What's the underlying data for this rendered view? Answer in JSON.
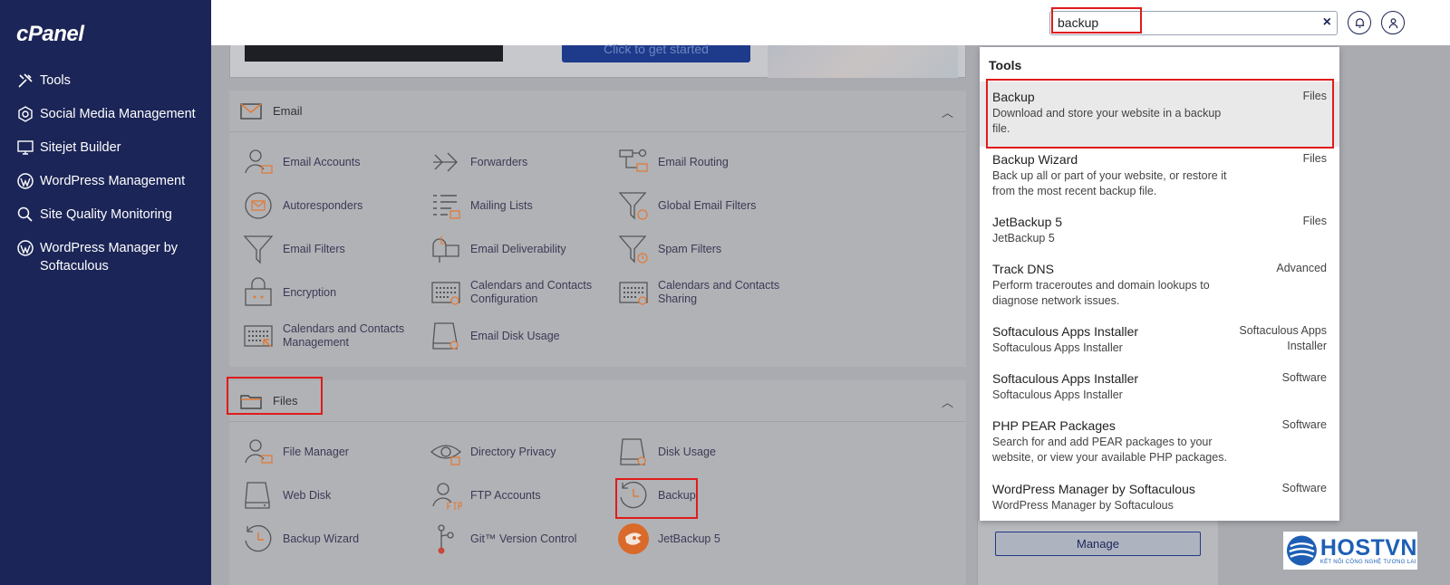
{
  "app": {
    "logo": "cPanel"
  },
  "sidebar": {
    "items": [
      {
        "label": "Tools",
        "icon": "tools-icon"
      },
      {
        "label": "Social Media Management",
        "icon": "social-media-icon"
      },
      {
        "label": "Sitejet Builder",
        "icon": "sitejet-icon"
      },
      {
        "label": "WordPress Management",
        "icon": "wordpress-icon"
      },
      {
        "label": "Site Quality Monitoring",
        "icon": "site-quality-icon"
      },
      {
        "label": "WordPress Manager by Softaculous",
        "icon": "wordpress-icon"
      }
    ]
  },
  "search": {
    "value": "backup",
    "clear": "×"
  },
  "banner": {
    "cta_label": "Click to get started"
  },
  "email_section": {
    "title": "Email",
    "tools": [
      {
        "label": "Email Accounts",
        "icon": "email-accounts-icon"
      },
      {
        "label": "Forwarders",
        "icon": "forwarders-icon"
      },
      {
        "label": "Email Routing",
        "icon": "email-routing-icon"
      },
      {
        "label": "Autoresponders",
        "icon": "autoresponders-icon"
      },
      {
        "label": "Mailing Lists",
        "icon": "mailing-lists-icon"
      },
      {
        "label": "Global Email Filters",
        "icon": "global-filter-icon"
      },
      {
        "label": "Email Filters",
        "icon": "filter-icon"
      },
      {
        "label": "Email Deliverability",
        "icon": "mailbox-icon"
      },
      {
        "label": "Spam Filters",
        "icon": "spam-filter-icon"
      },
      {
        "label": "Encryption",
        "icon": "encryption-icon"
      },
      {
        "label": "Calendars and Contacts Configuration",
        "icon": "calendar-config-icon"
      },
      {
        "label": "Calendars and Contacts Sharing",
        "icon": "calendar-share-icon"
      },
      {
        "label": "Calendars and Contacts Management",
        "icon": "calendar-manage-icon"
      },
      {
        "label": "Email Disk Usage",
        "icon": "disk-usage-icon"
      }
    ]
  },
  "files_section": {
    "title": "Files",
    "tools": [
      {
        "label": "File Manager",
        "icon": "file-manager-icon"
      },
      {
        "label": "Directory Privacy",
        "icon": "eye-icon"
      },
      {
        "label": "Disk Usage",
        "icon": "disk-usage-icon"
      },
      {
        "label": "Web Disk",
        "icon": "web-disk-icon"
      },
      {
        "label": "FTP Accounts",
        "icon": "ftp-icon"
      },
      {
        "label": "Backup",
        "icon": "backup-icon"
      },
      {
        "label": "Backup Wizard",
        "icon": "backup-wizard-icon"
      },
      {
        "label": "Git™ Version Control",
        "icon": "git-icon"
      },
      {
        "label": "JetBackup 5",
        "icon": "jetbackup-icon"
      }
    ]
  },
  "dropdown": {
    "heading": "Tools",
    "results": [
      {
        "title": "Backup",
        "desc": "Download and store your website in a backup file.",
        "category": "Files"
      },
      {
        "title": "Backup Wizard",
        "desc": "Back up all or part of your website, or restore it from the most recent backup file.",
        "category": "Files"
      },
      {
        "title": "JetBackup 5",
        "desc": "JetBackup 5",
        "category": "Files"
      },
      {
        "title": "Track DNS",
        "desc": "Perform traceroutes and domain lookups to diagnose network issues.",
        "category": "Advanced"
      },
      {
        "title": "Softaculous Apps Installer",
        "desc": "Softaculous Apps Installer",
        "category": "Softaculous Apps Installer"
      },
      {
        "title": "Softaculous Apps Installer",
        "desc": "Softaculous Apps Installer",
        "category": "Software"
      },
      {
        "title": "PHP PEAR Packages",
        "desc": "Search for and add PEAR packages to your website, or view your available PHP packages.",
        "category": "Software"
      },
      {
        "title": "WordPress Manager by Softaculous",
        "desc": "WordPress Manager by Softaculous",
        "category": "Software"
      }
    ]
  },
  "manage_label": "Manage",
  "watermark": {
    "name": "HOSTVN",
    "tagline": "KẾT NỐI CÔNG NGHỆ TƯƠNG LAI"
  },
  "colors": {
    "sidebar": "#1b2557",
    "accent": "#1e3a8a",
    "highlight": "#e01b1b",
    "icon_orange": "#e07b39"
  }
}
